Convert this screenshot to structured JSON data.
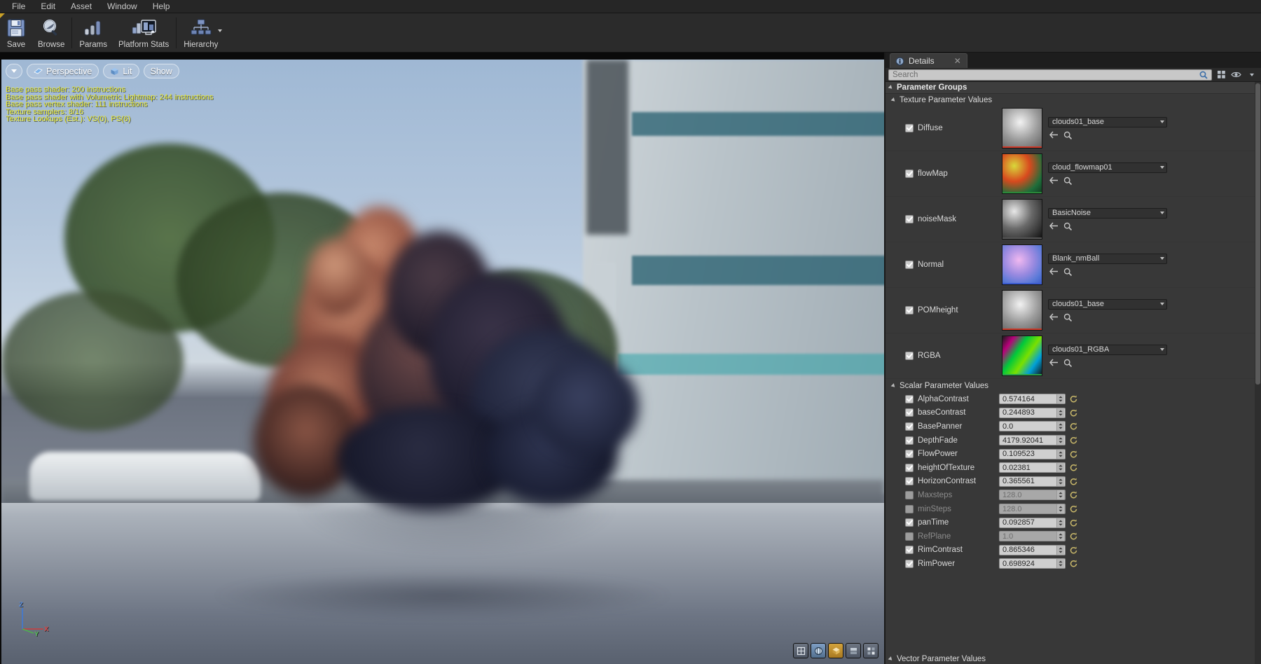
{
  "menubar": {
    "items": [
      "File",
      "Edit",
      "Asset",
      "Window",
      "Help"
    ]
  },
  "toolbar": {
    "buttons": [
      {
        "label": "Save",
        "icon": "save-icon"
      },
      {
        "label": "Browse",
        "icon": "browse-magnifier-icon"
      },
      {
        "label": "Params",
        "icon": "params-bars-icon"
      },
      {
        "label": "Platform Stats",
        "icon": "platform-stats-icon"
      },
      {
        "label": "Hierarchy",
        "icon": "hierarchy-tree-icon"
      }
    ]
  },
  "viewport": {
    "toolbar": {
      "menu_caret": "▼",
      "perspective": "Perspective",
      "lit": "Lit",
      "show": "Show"
    },
    "stats": [
      "Base pass shader: 200 instructions",
      "Base pass shader with Volumetric Lightmap: 244 instructions",
      "Base pass vertex shader: 111 instructions",
      "Texture samplers: 8/16",
      "Texture Lookups (Est.): VS(0), PS(6)"
    ],
    "gizmo": {
      "x": "X",
      "y": "Y",
      "z": "Z"
    },
    "corner_buttons": [
      "view-mode-1",
      "view-mode-2",
      "view-mode-3",
      "view-mode-4",
      "view-mode-5"
    ]
  },
  "details": {
    "tab_title": "Details",
    "tab_icon": "info-icon",
    "close_icon": "close-icon",
    "search": {
      "placeholder": "Search",
      "value": ""
    },
    "search_icon": "search-icon",
    "grid_view_icon": "grid-view-icon",
    "eye_icon": "eye-visibility-icon",
    "groups": {
      "root": "Parameter Groups",
      "texture": "Texture Parameter Values",
      "scalar": "Scalar Parameter Values",
      "vector": "Vector Parameter Values"
    },
    "texture_params": [
      {
        "name": "Diffuse",
        "checked": true,
        "asset": "clouds01_base",
        "thumb": "clouds-grey",
        "bar": "#cf3a2a"
      },
      {
        "name": "flowMap",
        "checked": true,
        "asset": "cloud_flowmap01",
        "thumb": "flowmap",
        "bar": "#2a8a3a"
      },
      {
        "name": "noiseMask",
        "checked": true,
        "asset": "BasicNoise",
        "thumb": "noise",
        "bar": "#555555"
      },
      {
        "name": "Normal",
        "checked": true,
        "asset": "Blank_nmBall",
        "thumb": "normal",
        "bar": "#3a5acf"
      },
      {
        "name": "POMheight",
        "checked": true,
        "asset": "clouds01_base",
        "thumb": "clouds-grey",
        "bar": "#cf3a2a"
      },
      {
        "name": "RGBA",
        "checked": true,
        "asset": "clouds01_RGBA",
        "thumb": "rgba",
        "bar": "#2aa04a"
      }
    ],
    "texture_row_actions": [
      "back-arrow-icon",
      "browse-magnifier-icon"
    ],
    "scalar_params": [
      {
        "name": "AlphaContrast",
        "checked": true,
        "value": "0.574164",
        "enabled": true
      },
      {
        "name": "baseContrast",
        "checked": true,
        "value": "0.244893",
        "enabled": true
      },
      {
        "name": "BasePanner",
        "checked": true,
        "value": "0.0",
        "enabled": true
      },
      {
        "name": "DepthFade",
        "checked": true,
        "value": "4179.92041",
        "enabled": true
      },
      {
        "name": "FlowPower",
        "checked": true,
        "value": "0.109523",
        "enabled": true
      },
      {
        "name": "heightOfTexture",
        "checked": true,
        "value": "0.02381",
        "enabled": true
      },
      {
        "name": "HorizonContrast",
        "checked": true,
        "value": "0.365561",
        "enabled": true
      },
      {
        "name": "Maxsteps",
        "checked": false,
        "value": "128.0",
        "enabled": false
      },
      {
        "name": "minSteps",
        "checked": false,
        "value": "128.0",
        "enabled": false
      },
      {
        "name": "panTime",
        "checked": true,
        "value": "0.092857",
        "enabled": true
      },
      {
        "name": "RefPlane",
        "checked": false,
        "value": "1.0",
        "enabled": false
      },
      {
        "name": "RimContrast",
        "checked": true,
        "value": "0.865346",
        "enabled": true
      },
      {
        "name": "RimPower",
        "checked": true,
        "value": "0.698924",
        "enabled": true
      }
    ],
    "reset_icon": "reset-arrow-icon",
    "spinner_icon": "spinner-arrows-icon"
  }
}
